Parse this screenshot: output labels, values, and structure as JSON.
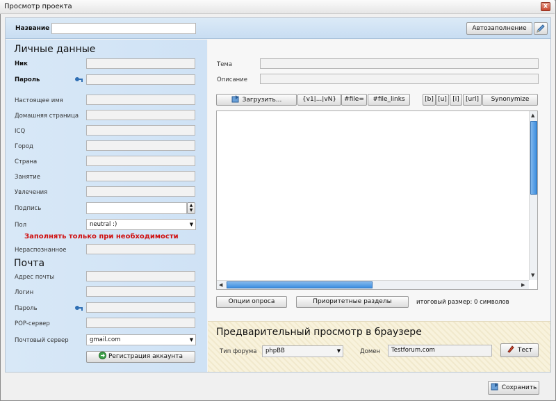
{
  "window": {
    "title": "Просмотр проекта",
    "close_glyph": "x"
  },
  "top": {
    "name_label": "Название",
    "name_value": "",
    "autofill_button": "Автозаполнение"
  },
  "personal": {
    "section_title": "Личные данные",
    "fields": {
      "nick": "Ник",
      "password": "Пароль",
      "real_name": "Настоящее имя",
      "homepage": "Домашняя страница",
      "icq": "ICQ",
      "city": "Город",
      "country": "Страна",
      "occupation": "Занятие",
      "hobbies": "Увлечения",
      "signature": "Подпись",
      "gender": "Пол"
    },
    "gender_value": "neutral :)",
    "warning": "Заполнять только при необходимости",
    "unrecognized": "Нераспознанное"
  },
  "mail": {
    "section_title": "Почта",
    "fields": {
      "address": "Адрес почты",
      "login": "Логин",
      "password": "Пароль",
      "pop": "POP-сервер",
      "mail_server": "Почтовый сервер"
    },
    "mail_server_value": "gmail.com",
    "register_button": "Регистрация аккаунта"
  },
  "post": {
    "topic_label": "Тема",
    "description_label": "Описание",
    "toolbar": {
      "upload": "Загрузить...",
      "variants": "{v1|...|vN}",
      "file": "#file=",
      "file_links": "#file_links",
      "bold": "[b]",
      "underline": "[u]",
      "italic": "[i]",
      "url": "[url]",
      "synonymize": "Synonymize"
    },
    "body_text": "",
    "poll_options_button": "Опции опроса",
    "priority_sections_button": "Приоритетные разделы",
    "total_size": "итоговый размер: 0 символов"
  },
  "preview": {
    "title": "Предварительный просмотр в браузере",
    "forum_type_label": "Тип форума",
    "forum_type_value": "phpBB",
    "domain_label": "Домен",
    "domain_value": "Testforum.com",
    "test_button": "Тест"
  },
  "footer": {
    "save_button": "Сохранить"
  },
  "colors": {
    "band": "#c8ddf2",
    "warning": "#d01010",
    "scroll_thumb": "#3d8fe0",
    "preview_bg": "#f8f2dc"
  }
}
